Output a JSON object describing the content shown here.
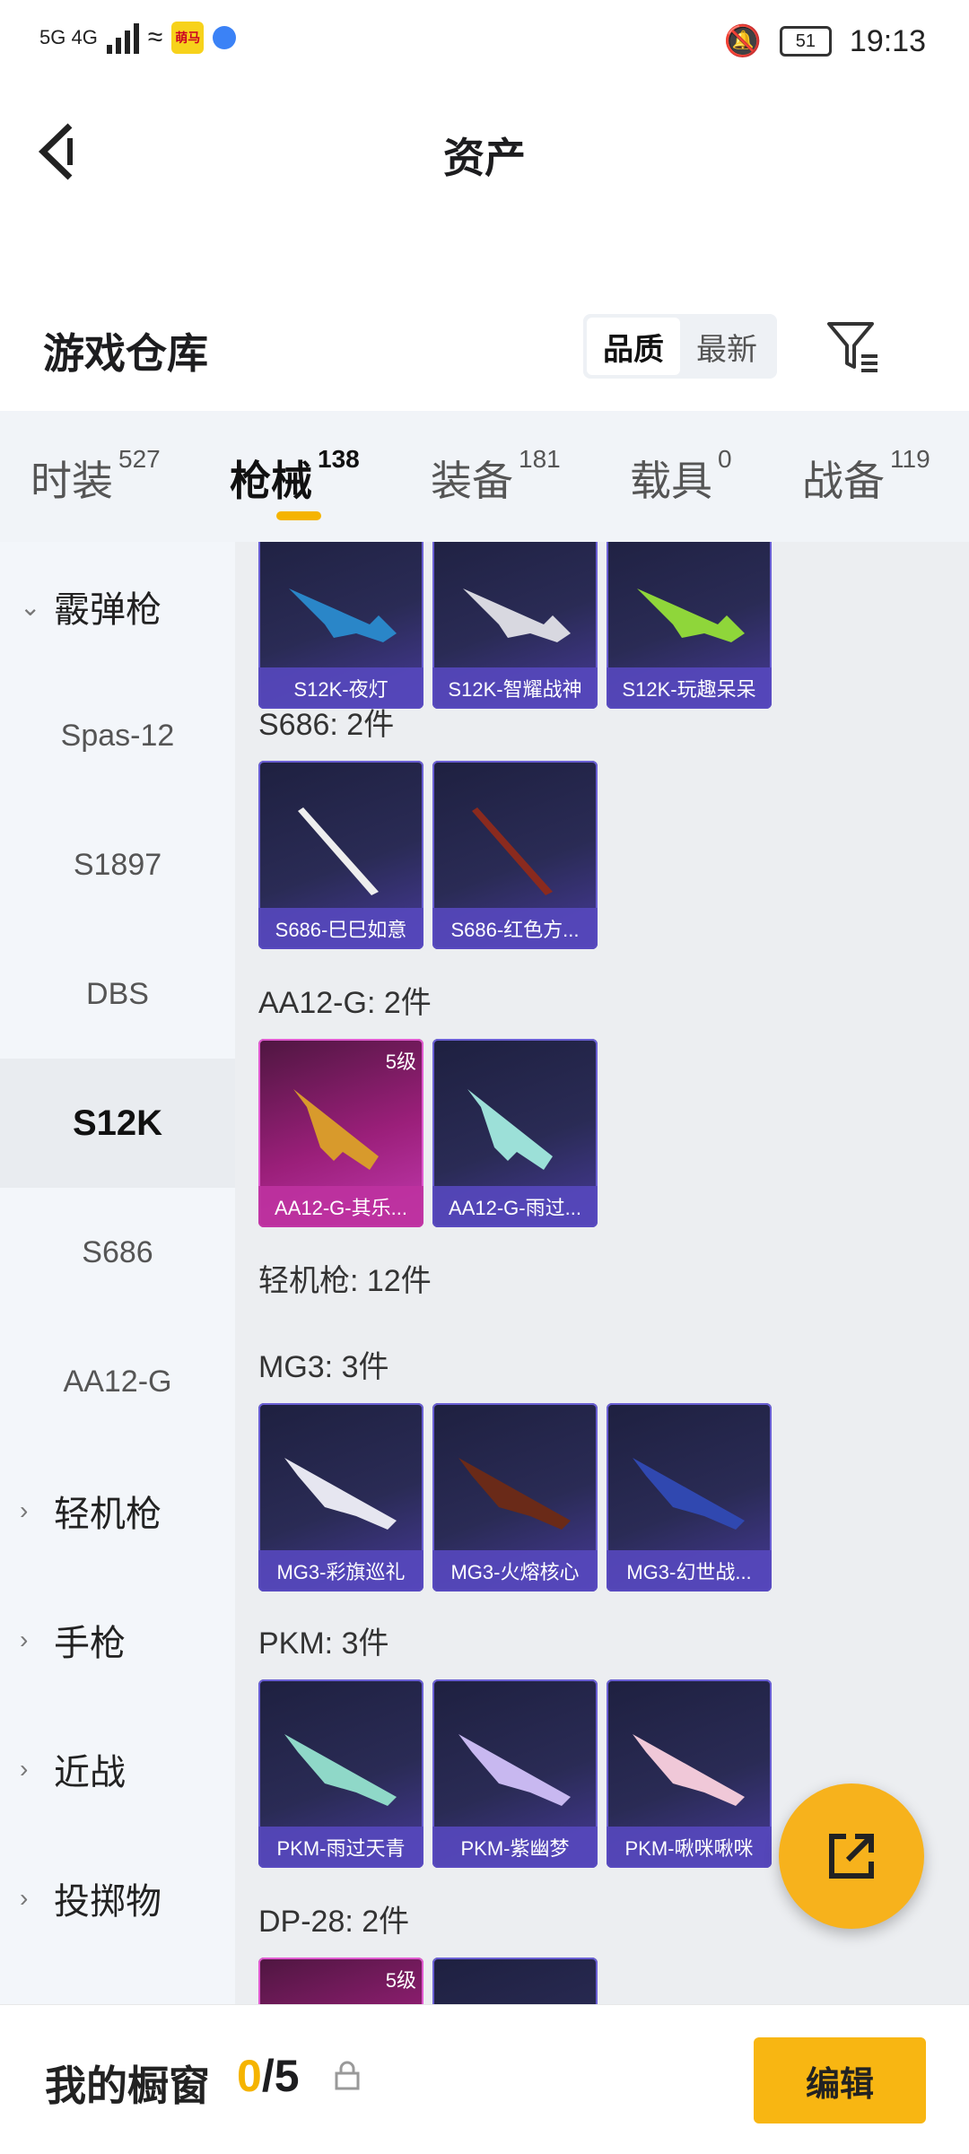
{
  "status": {
    "network": "5G  4G",
    "app_badge": "萌马",
    "battery": "51",
    "time": "19:13"
  },
  "header": {
    "title": "资产"
  },
  "section": {
    "title": "游戏仓库",
    "sort_options": [
      "品质",
      "最新"
    ],
    "active_sort": "品质"
  },
  "tabs": [
    {
      "label": "时装",
      "count": "527"
    },
    {
      "label": "枪械",
      "count": "138"
    },
    {
      "label": "装备",
      "count": "181"
    },
    {
      "label": "载具",
      "count": "0"
    },
    {
      "label": "战备",
      "count": "119"
    }
  ],
  "active_tab": "枪械",
  "sidebar": {
    "group1": "霰弹枪",
    "sub_items": [
      "Spas-12",
      "S1897",
      "DBS",
      "S12K",
      "S686",
      "AA12-G"
    ],
    "active": "S12K",
    "groups": [
      "轻机枪",
      "手枪",
      "近战",
      "投掷物"
    ]
  },
  "content": {
    "row0": [
      "S12K-夜灯",
      "S12K-智耀战神",
      "S12K-玩趣呆呆"
    ],
    "s686_label": "S686: 2件",
    "s686": [
      "S686-巳巳如意",
      "S686-红色方..."
    ],
    "aa12_label": "AA12-G: 2件",
    "aa12": [
      "AA12-G-其乐...",
      "AA12-G-雨过..."
    ],
    "aa12_level": "5级",
    "lmg_label": "轻机枪: 12件",
    "mg3_label": "MG3: 3件",
    "mg3": [
      "MG3-彩旗巡礼",
      "MG3-火熔核心",
      "MG3-幻世战..."
    ],
    "pkm_label": "PKM: 3件",
    "pkm": [
      "PKM-雨过天青",
      "PKM-紫幽梦",
      "PKM-啾咪啾咪"
    ],
    "dp28_label": "DP-28: 2件",
    "dp28_level": "5级"
  },
  "bottom": {
    "label": "我的橱窗",
    "current": "0",
    "total": "/5",
    "edit": "编辑"
  },
  "colors": {
    "accent": "#f5b400",
    "card_purple": "#473a9a",
    "card_gold": "#9b1f7a"
  }
}
